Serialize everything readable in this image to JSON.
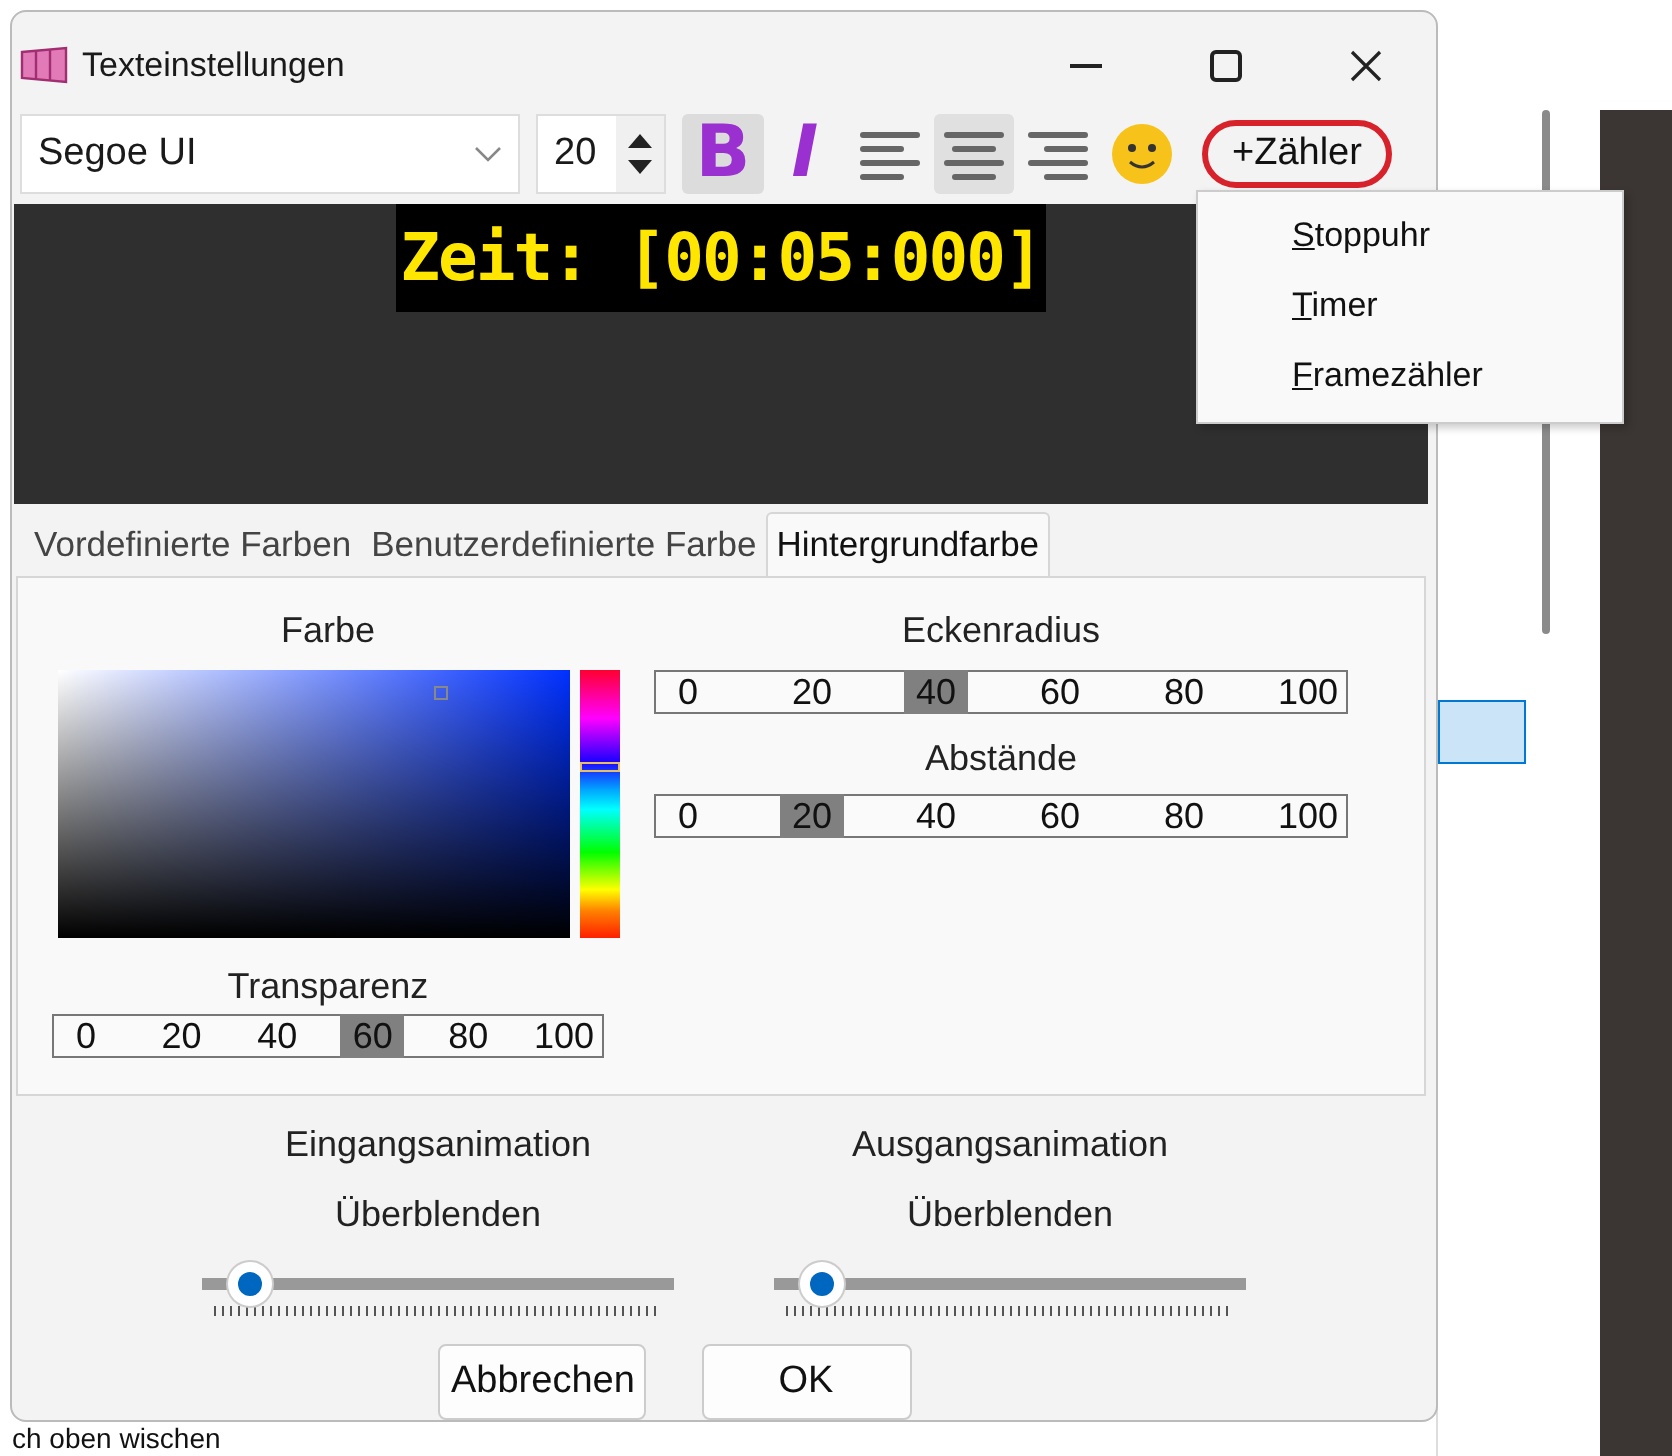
{
  "window": {
    "title": "Texteinstellungen"
  },
  "toolbar": {
    "font": "Segoe UI",
    "size": "20",
    "styles": [
      {
        "kind": "bold",
        "label": "B",
        "on": true
      },
      {
        "kind": "italic",
        "label": "I",
        "on": false
      }
    ],
    "alignment": [
      {
        "kind": "left",
        "selected": false
      },
      {
        "kind": "center",
        "selected": true
      },
      {
        "kind": "right",
        "selected": false
      }
    ],
    "counter_button": {
      "label": "+Zähler",
      "circled": true
    }
  },
  "counter_menu": [
    "Stoppuhr",
    "Timer",
    "Framezähler"
  ],
  "preview": {
    "text": "Zeit: [00:05:000]"
  },
  "tabs": [
    {
      "label": "Vordefinierte Farben",
      "selected": false
    },
    {
      "label": "Benutzerdefinierte Farbe",
      "selected": false
    },
    {
      "label": "Hintergrundfarbe",
      "selected": true
    }
  ],
  "color": {
    "label": "Farbe"
  },
  "transparency": {
    "label": "Transparenz",
    "ticks": [
      {
        "label": "0",
        "selected": false
      },
      {
        "label": "20",
        "selected": false
      },
      {
        "label": "40",
        "selected": false
      },
      {
        "label": "60",
        "selected": true
      },
      {
        "label": "80",
        "selected": false
      },
      {
        "label": "100",
        "selected": false
      }
    ]
  },
  "corner_radius": {
    "label": "Eckenradius",
    "ticks": [
      {
        "label": "0",
        "selected": false
      },
      {
        "label": "20",
        "selected": false
      },
      {
        "label": "40",
        "selected": true
      },
      {
        "label": "60",
        "selected": false
      },
      {
        "label": "80",
        "selected": false
      },
      {
        "label": "100",
        "selected": false
      }
    ]
  },
  "spacing": {
    "label": "Abstände",
    "ticks": [
      {
        "label": "0",
        "selected": false
      },
      {
        "label": "20",
        "selected": true
      },
      {
        "label": "40",
        "selected": false
      },
      {
        "label": "60",
        "selected": false
      },
      {
        "label": "80",
        "selected": false
      },
      {
        "label": "100",
        "selected": false
      }
    ]
  },
  "animations": [
    {
      "label": "Eingangsanimation",
      "effect": "Überblenden",
      "level": 0.1
    },
    {
      "label": "Ausgangsanimation",
      "effect": "Überblenden",
      "level": 0.1
    }
  ],
  "buttons": [
    "Abbrechen",
    "OK"
  ],
  "background": {
    "text": "ch oben wischen"
  }
}
